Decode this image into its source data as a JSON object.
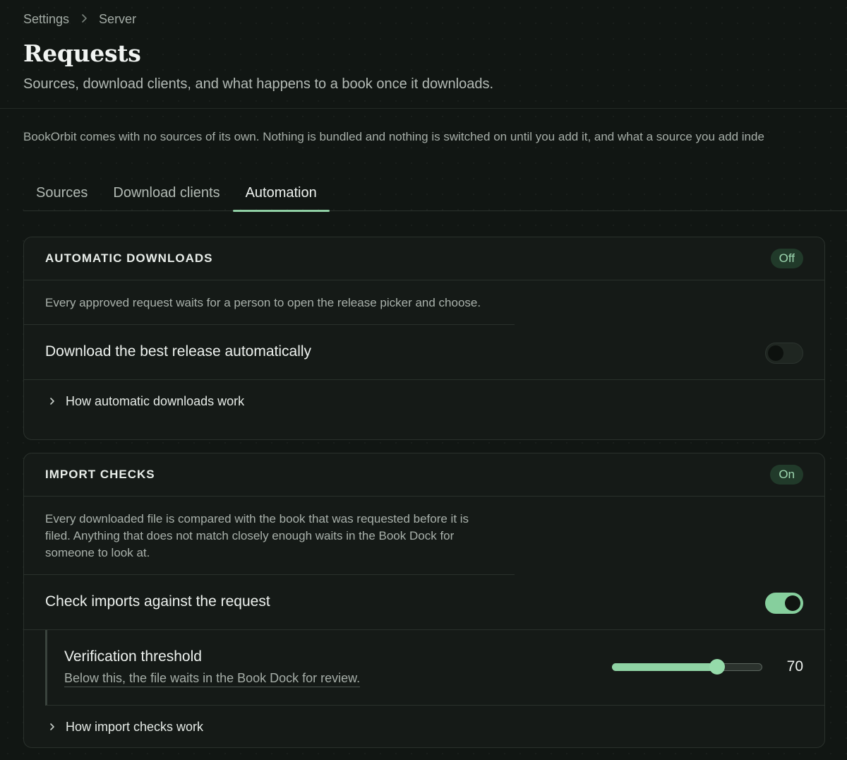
{
  "breadcrumb": {
    "root": "Settings",
    "current": "Server"
  },
  "page": {
    "title": "Requests",
    "subtitle": "Sources, download clients, and what happens to a book once it downloads."
  },
  "intro": "BookOrbit comes with no sources of its own. Nothing is bundled and nothing is switched on until you add it, and what a source you add inde",
  "tabs": [
    {
      "label": "Sources",
      "active": false
    },
    {
      "label": "Download clients",
      "active": false
    },
    {
      "label": "Automation",
      "active": true
    }
  ],
  "automatic_downloads": {
    "title": "AUTOMATIC DOWNLOADS",
    "status": "Off",
    "description": "Every approved request waits for a person to open the release picker and choose.",
    "setting_label": "Download the best release automatically",
    "enabled": false,
    "expander_label": "How automatic downloads work"
  },
  "import_checks": {
    "title": "IMPORT CHECKS",
    "status": "On",
    "description": "Every downloaded file is compared with the book that was requested before it is filed. Anything that does not match closely enough waits in the Book Dock for someone to look at.",
    "setting_label": "Check imports against the request",
    "enabled": true,
    "threshold": {
      "title": "Verification threshold",
      "help": "Below this, the file waits in the Book Dock for review.",
      "value": 70,
      "display_value": "70",
      "min": 0,
      "max": 100
    },
    "expander_label": "How import checks work"
  },
  "colors": {
    "accent": "#8fcfa4",
    "background": "#111613",
    "card": "#151a17",
    "badge_bg": "#213a2a",
    "badge_text": "#9ed8b1"
  },
  "icons": {
    "breadcrumb_separator": "chevron-right-icon",
    "expander": "chevron-right-icon"
  }
}
